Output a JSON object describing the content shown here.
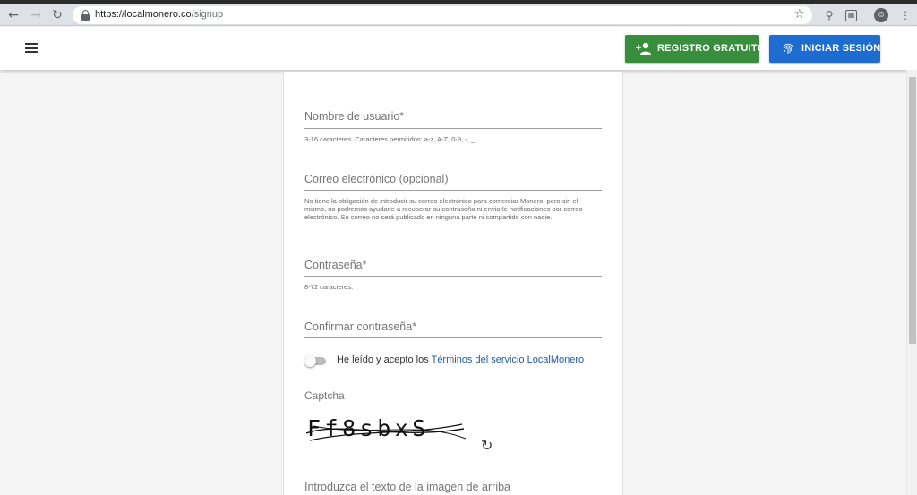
{
  "browser": {
    "url_host": "https://localmonero.co",
    "url_path": "/signup"
  },
  "header": {
    "register_label": "REGISTRO GRATUITO",
    "login_label": "INICIAR SESIÓN",
    "register_color": "#388e3c",
    "login_color": "#1e6ccf"
  },
  "form": {
    "username": {
      "placeholder": "Nombre de usuario*",
      "hint": "3-16 caracteres. Caracteres permitidos: a-z, A-Z, 0-9, -, _"
    },
    "email": {
      "placeholder": "Correo electrónico (opcional)",
      "hint": "No tiene la obligación de introducir su correo electrónico para comerciar Monero, pero sin el mismo, no podremos ayudarle a recuperar su contraseña ni enviarle notificaciones por correo electrónico. Su correo no será publicado en ninguna parte ni compartido con nadie."
    },
    "password": {
      "placeholder": "Contraseña*",
      "hint": "8-72 caracteres."
    },
    "confirm_password": {
      "placeholder": "Confirmar contraseña*"
    },
    "terms": {
      "text": "He leído y acepto los ",
      "link": "Términos del servicio LocalMonero",
      "checked": false
    },
    "captcha": {
      "label": "Captcha",
      "image_text": "Ff8sbxS",
      "input_placeholder": "Introduzca el texto de la imagen de arriba"
    }
  },
  "icons": {
    "back": "arrow-left-icon",
    "forward": "arrow-right-icon",
    "reload": "reload-icon",
    "lock": "lock-icon",
    "star": "star-icon",
    "menu": "hamburger-icon",
    "add_user": "add-user-icon",
    "fingerprint": "fingerprint-icon",
    "refresh": "refresh-icon"
  }
}
